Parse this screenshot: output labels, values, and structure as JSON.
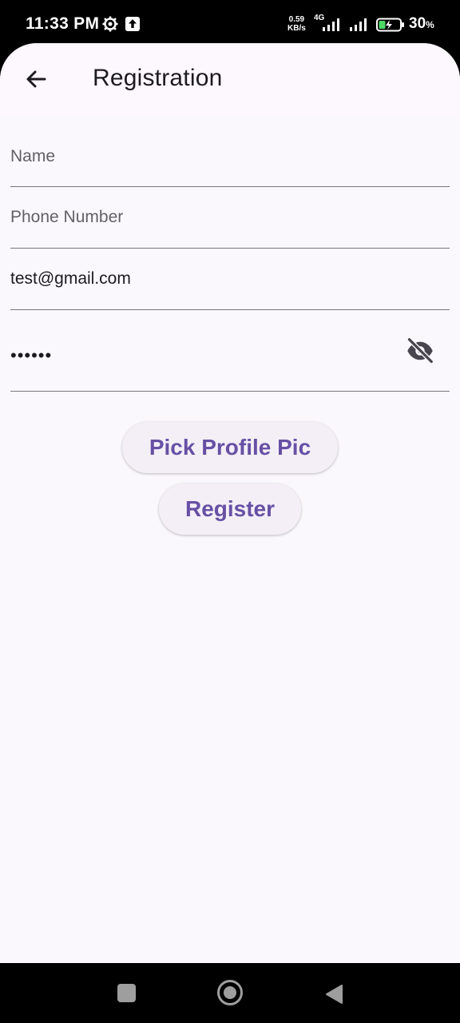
{
  "status_bar": {
    "time": "11:33 PM",
    "net_speed_value": "0.59",
    "net_speed_unit": "KB/s",
    "network_type": "4G",
    "battery_percent": "30",
    "battery_percent_sign": "%"
  },
  "app_bar": {
    "title": "Registration",
    "back_icon": "arrow-back-icon"
  },
  "form": {
    "name": {
      "value": "",
      "placeholder": "Name"
    },
    "phone": {
      "value": "",
      "placeholder": "Phone Number"
    },
    "email": {
      "value": "test@gmail.com"
    },
    "password": {
      "value": "••••••",
      "toggle_icon": "visibility-off-icon"
    }
  },
  "buttons": {
    "pick_profile_pic": "Pick Profile Pic",
    "register": "Register"
  },
  "colors": {
    "accent": "#6750a4",
    "button_bg": "#f4eff7",
    "screen_bg": "#faf8fd",
    "app_bar_bg": "#fdf7fe"
  }
}
